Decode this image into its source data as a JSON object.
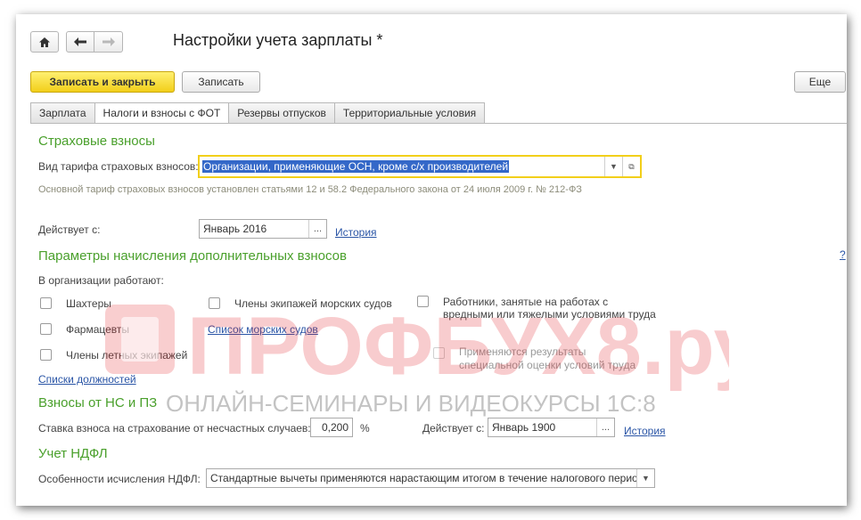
{
  "header": {
    "title": "Настройки учета зарплаты *",
    "home_icon": "home-icon",
    "back_icon": "arrow-left-icon",
    "forward_icon": "arrow-right-icon"
  },
  "toolbar": {
    "save_close": "Записать и закрыть",
    "save": "Записать",
    "more": "Еще"
  },
  "tabs": [
    {
      "label": "Зарплата",
      "active": false
    },
    {
      "label": "Налоги и взносы с ФОТ",
      "active": true
    },
    {
      "label": "Резервы отпусков",
      "active": false
    },
    {
      "label": "Территориальные условия",
      "active": false
    }
  ],
  "insurance": {
    "heading": "Страховые взносы",
    "tariff_label": "Вид тарифа страховых взносов:",
    "tariff_value": "Организации, применяющие ОСН, кроме с/х производителей",
    "tariff_note": "Основной тариф страховых взносов установлен статьями 12 и 58.2 Федерального закона от 24 июля 2009 г. № 212-ФЗ",
    "effective_label": "Действует с:",
    "effective_value": "Январь 2016",
    "history_link": "История"
  },
  "additional": {
    "heading": "Параметры начисления дополнительных взносов",
    "help_mark": "?",
    "org_employs": "В организации работают:",
    "miners": "Шахтеры",
    "pharmacists": "Фармацевты",
    "flight_crew": "Члены летных экипажей",
    "sea_crew": "Члены экипажей морских судов",
    "ships_list_link": "Список морских судов",
    "hazard_line1": "Работники, занятые на работах с",
    "hazard_line2": "вредными или тяжелыми условиями труда",
    "special_line1": "Применяются результаты",
    "special_line2": "специальной оценки условий труда",
    "positions_link": "Списки должностей"
  },
  "accident": {
    "heading": "Взносы от НС и ПЗ",
    "rate_label": "Ставка взноса на страхование от несчастных случаев:",
    "rate_value": "0,200",
    "rate_unit": "%",
    "effective_label": "Действует с:",
    "effective_value": "Январь 1900",
    "history_link": "История"
  },
  "ndfl": {
    "heading": "Учет НДФЛ",
    "calc_label": "Особенности исчисления НДФЛ:",
    "calc_value": "Стандартные вычеты применяются нарастающим итогом в течение налогового периода"
  },
  "watermark": {
    "brand": "ПРОФБУХ8.ру",
    "tagline": "ОНЛАЙН-СЕМИНАРЫ И ВИДЕОКУРСЫ 1С:8"
  },
  "colors": {
    "accent_yellow": "#f2cf1a",
    "section_green": "#4aa02c",
    "link_blue": "#2a55a6",
    "watermark_red": "#e31e24"
  }
}
